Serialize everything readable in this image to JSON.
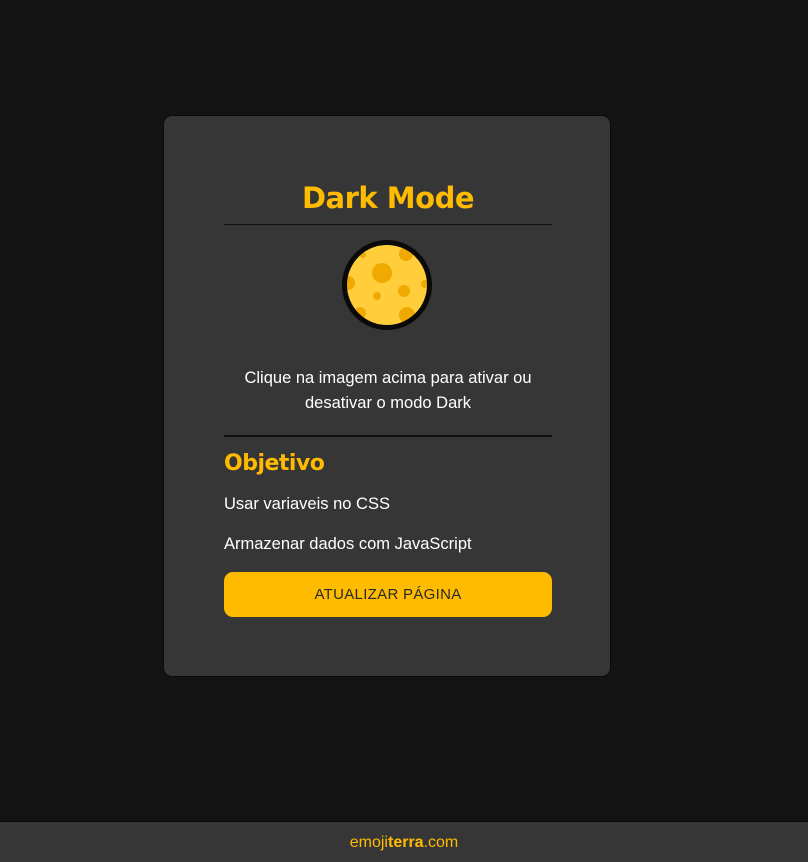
{
  "card": {
    "title": "Dark Mode",
    "moon_icon": "moon-icon",
    "instructions": "Clique na imagem acima para ativar ou desativar o modo Dark",
    "subtitle": "Objetivo",
    "goals": [
      "Usar variaveis no CSS",
      "Armazenar dados com JavaScript"
    ],
    "refresh_label": "ATUALIZAR PÁGINA"
  },
  "footer": {
    "link_part1": "emoji",
    "link_part2": "terra",
    "link_part3": ".com"
  },
  "colors": {
    "background": "#131313",
    "card": "#363636",
    "accent": "#ffbb00",
    "text": "#ffffff"
  }
}
